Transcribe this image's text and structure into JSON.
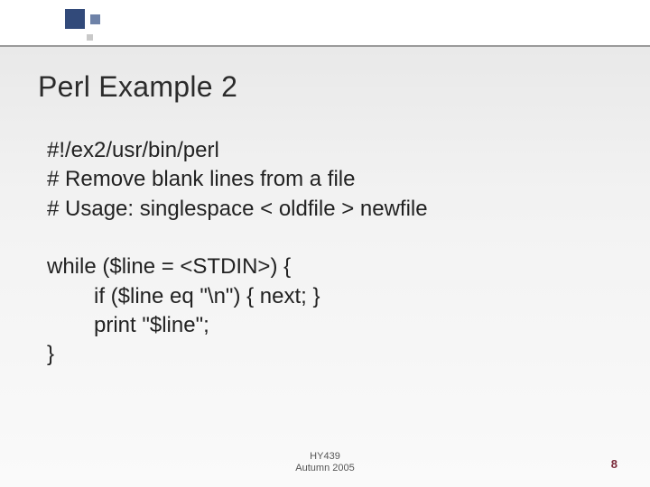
{
  "title": "Perl Example 2",
  "code": {
    "l1": "#!/ex2/usr/bin/perl",
    "l2": "# Remove blank lines from a file",
    "l3": "# Usage: singlespace < oldfile > newfile",
    "l4": "while ($line = <STDIN>) {",
    "l5": "if ($line eq \"\\n\") { next; }",
    "l6": "print \"$line\";",
    "l7": "}"
  },
  "footer": {
    "course": "HY439",
    "term": "Autumn 2005",
    "page": "8"
  }
}
